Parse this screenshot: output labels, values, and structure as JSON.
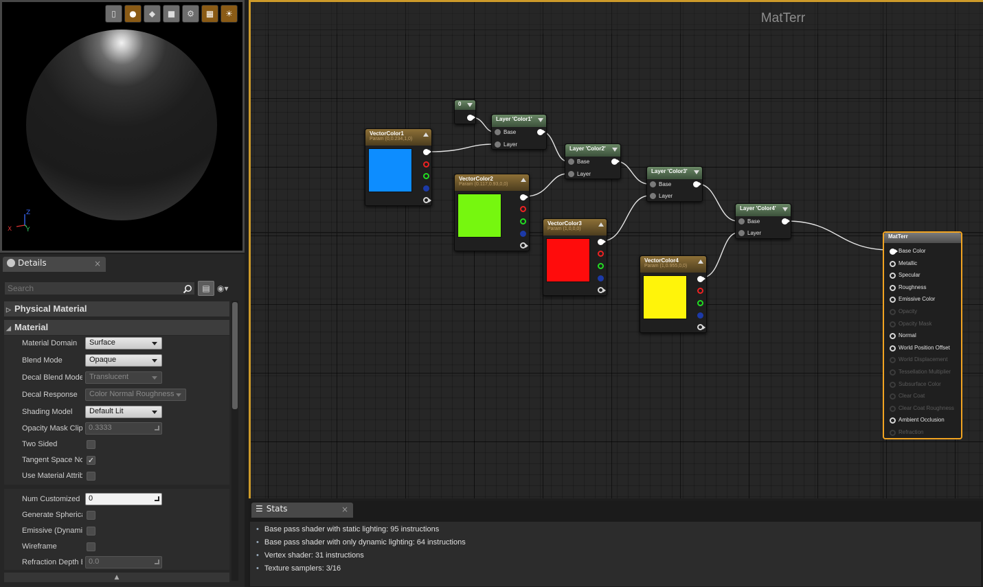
{
  "viewport": {
    "toolbar": [
      {
        "icon": "cylinder-preview-icon",
        "active": false
      },
      {
        "icon": "sphere-preview-icon",
        "active": true
      },
      {
        "icon": "plane-preview-icon",
        "active": false
      },
      {
        "icon": "cube-preview-icon",
        "active": false
      },
      {
        "icon": "custom-mesh-preview-icon",
        "active": false
      },
      {
        "icon": "grid-toggle-icon",
        "active": true
      },
      {
        "icon": "realtime-toggle-icon",
        "active": true
      }
    ],
    "axis": {
      "z": "Z",
      "x": "X",
      "y": "Y"
    }
  },
  "details": {
    "tab_label": "Details",
    "close": "×",
    "search_placeholder": "Search",
    "categories": {
      "physical_material": "Physical Material",
      "material": "Material"
    },
    "properties": {
      "material_domain": {
        "label": "Material Domain",
        "value": "Surface"
      },
      "blend_mode": {
        "label": "Blend Mode",
        "value": "Opaque"
      },
      "decal_blend_mode": {
        "label": "Decal Blend Mode",
        "value": "Translucent"
      },
      "decal_response": {
        "label": "Decal Response",
        "value": "Color Normal Roughness"
      },
      "shading_model": {
        "label": "Shading Model",
        "value": "Default Lit"
      },
      "opacity_mask_clip": {
        "label": "Opacity Mask Clip Value",
        "value": "0.3333"
      },
      "two_sided": {
        "label": "Two Sided",
        "checked": false
      },
      "tangent_space_normal": {
        "label": "Tangent Space Normal",
        "checked": true
      },
      "use_material_attributes": {
        "label": "Use Material Attributes",
        "checked": false
      },
      "num_customized_uvs": {
        "label": "Num Customized UVs",
        "value": "0"
      },
      "generate_spherical": {
        "label": "Generate Spherical Particle Normals",
        "checked": false
      },
      "emissive_dynamic": {
        "label": "Emissive (Dynamic Area Light)",
        "checked": false
      },
      "wireframe": {
        "label": "Wireframe",
        "checked": false
      },
      "refraction_depth": {
        "label": "Refraction Depth Bias",
        "value": "0.0"
      }
    }
  },
  "graph": {
    "title": "MatTerr",
    "nodes": {
      "const0": {
        "title": "0"
      },
      "vc1": {
        "title": "VectorColor1",
        "param": "Param (0,0.234,1,0)",
        "color": "#0d8dff"
      },
      "vc2": {
        "title": "VectorColor2",
        "param": "Param (0.117,0.93,0,0)",
        "color": "#76f70f"
      },
      "vc3": {
        "title": "VectorColor3",
        "param": "Param (1,0,0,0)",
        "color": "#ff0c0c"
      },
      "vc4": {
        "title": "VectorColor4",
        "param": "Param (1,0.955,0,0)",
        "color": "#fff40a"
      },
      "layer1": {
        "title": "Layer 'Color1'"
      },
      "layer2": {
        "title": "Layer 'Color2'"
      },
      "layer3": {
        "title": "Layer 'Color3'"
      },
      "layer4": {
        "title": "Layer 'Color4'"
      },
      "pin_base": "Base",
      "pin_layer": "Layer"
    },
    "result_node": {
      "title": "MatTerr",
      "inputs": [
        {
          "label": "Base Color",
          "enabled": true,
          "connected": true
        },
        {
          "label": "Metallic",
          "enabled": true,
          "connected": false
        },
        {
          "label": "Specular",
          "enabled": true,
          "connected": false
        },
        {
          "label": "Roughness",
          "enabled": true,
          "connected": false
        },
        {
          "label": "Emissive Color",
          "enabled": true,
          "connected": false
        },
        {
          "label": "Opacity",
          "enabled": false,
          "connected": false
        },
        {
          "label": "Opacity Mask",
          "enabled": false,
          "connected": false
        },
        {
          "label": "Normal",
          "enabled": true,
          "connected": false
        },
        {
          "label": "World Position Offset",
          "enabled": true,
          "connected": false
        },
        {
          "label": "World Displacement",
          "enabled": false,
          "connected": false
        },
        {
          "label": "Tessellation Multiplier",
          "enabled": false,
          "connected": false
        },
        {
          "label": "Subsurface Color",
          "enabled": false,
          "connected": false
        },
        {
          "label": "Clear Coat",
          "enabled": false,
          "connected": false
        },
        {
          "label": "Clear Coat Roughness",
          "enabled": false,
          "connected": false
        },
        {
          "label": "Ambient Occlusion",
          "enabled": true,
          "connected": false
        },
        {
          "label": "Refraction",
          "enabled": false,
          "connected": false
        }
      ]
    }
  },
  "stats": {
    "tab_label": "Stats",
    "close": "×",
    "lines": [
      "Base pass shader with static lighting: 95 instructions",
      "Base pass shader with only dynamic lighting: 64 instructions",
      "Vertex shader: 31 instructions",
      "Texture samplers: 3/16"
    ]
  },
  "colors": {
    "accent": "#cc9a2a",
    "result_node_border": "#f2a421",
    "parameter_header": "#8d7037",
    "layer_header": "#6a8866"
  }
}
